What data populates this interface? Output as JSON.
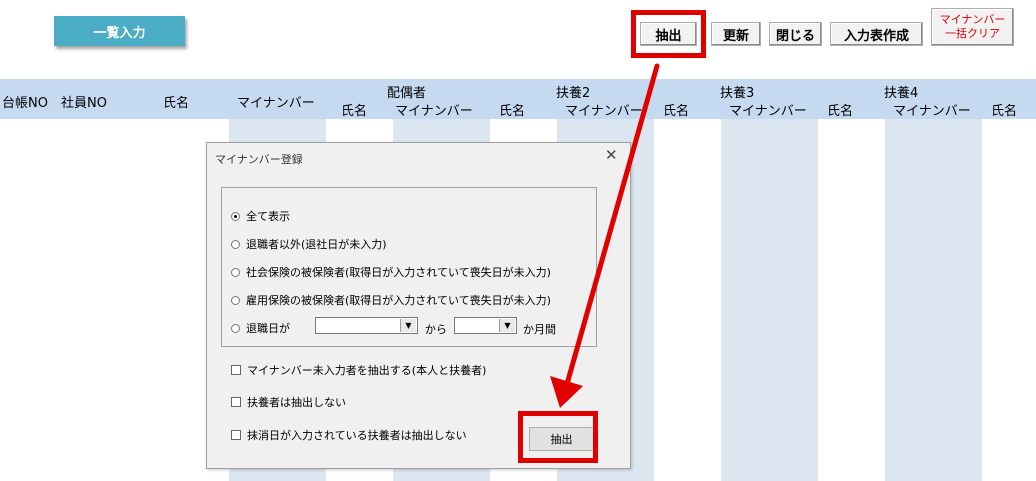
{
  "toolbar": {
    "ichiran_label": "一覧入力",
    "chushutsu_label": "抽出",
    "koushin_label": "更新",
    "tojiru_label": "閉じる",
    "nyuryokuhyo_label": "入力表作成",
    "clear_line1": "マイナンバー",
    "clear_line2": "一括クリア"
  },
  "table_header": {
    "daicho_no": "台帳NO",
    "shain_no": "社員NO",
    "shimei": "氏名",
    "mynumber": "マイナンバー",
    "haigusha": "配偶者",
    "haigusha_shimei": "氏名",
    "haigusha_mynumber": "マイナンバー",
    "fuyo1_shimei": "氏名",
    "fuyo2": "扶養2",
    "fuyo2_mynumber": "マイナンバー",
    "fuyo2_shimei": "氏名",
    "fuyo3": "扶養3",
    "fuyo3_mynumber": "マイナンバー",
    "fuyo3_shimei": "氏名",
    "fuyo4": "扶養4",
    "fuyo4_mynumber": "マイナンバー",
    "fuyo4_shimei": "氏名"
  },
  "dialog": {
    "title": "マイナンバー登録",
    "close_symbol": "✕",
    "options": [
      "全て表示",
      "退職者以外(退社日が未入力)",
      "社会保険の被保険者(取得日が入力されていて喪失日が未入力)",
      "雇用保険の被保険者(取得日が入力されていて喪失日が未入力)",
      "退職日が"
    ],
    "selected_option": 0,
    "kara_label": "から",
    "kagetsukan_label": "か月間",
    "checkboxes": [
      "マイナンバー未入力者を抽出する(本人と扶養者)",
      "扶養者は抽出しない",
      "抹消日が入力されている扶養者は抽出しない"
    ],
    "extract_button": "抽出"
  },
  "colors": {
    "accent": "#4bacc6",
    "highlight": "#e00000",
    "header_band": "#c5d9f1",
    "column_stripe": "#dce6f1"
  }
}
